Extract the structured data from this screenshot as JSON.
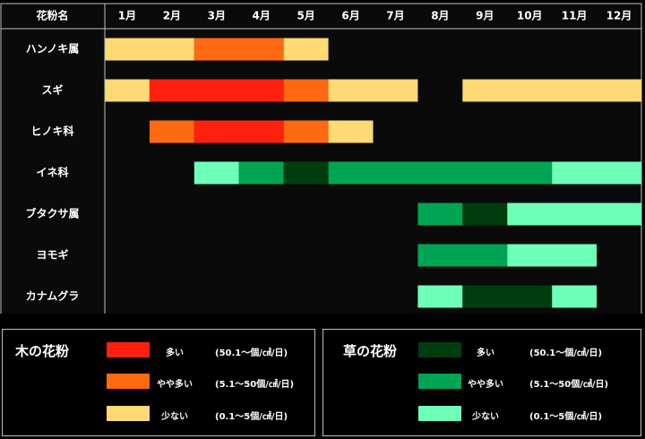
{
  "chart_data": {
    "type": "timeline-heatmap",
    "header_label": "花粉名",
    "months": [
      "1月",
      "2月",
      "3月",
      "4月",
      "5月",
      "6月",
      "7月",
      "8月",
      "9月",
      "10月",
      "11月",
      "12月"
    ],
    "levels": {
      "high": {
        "label": "多い",
        "range": "(50.1～個/㎠/日)"
      },
      "mid": {
        "label": "やや多い",
        "range": "(5.1～50個/㎠/日)"
      },
      "low": {
        "label": "少ない",
        "range": "(0.1～5個/㎠/日)"
      }
    },
    "colors": {
      "tree": {
        "high": "#ff2010",
        "mid": "#ff6a10",
        "low": "#ffd973"
      },
      "grass": {
        "high": "#003d0e",
        "mid": "#00a553",
        "low": "#6effb8"
      }
    },
    "rows": [
      {
        "name": "ハンノキ属",
        "kind": "tree",
        "segments": [
          {
            "start": 1,
            "end": 3,
            "level": "low"
          },
          {
            "start": 3,
            "end": 5,
            "level": "mid"
          },
          {
            "start": 5,
            "end": 6,
            "level": "low"
          }
        ]
      },
      {
        "name": "スギ",
        "kind": "tree",
        "segments": [
          {
            "start": 1,
            "end": 2,
            "level": "low"
          },
          {
            "start": 2,
            "end": 5,
            "level": "high"
          },
          {
            "start": 5,
            "end": 6,
            "level": "mid"
          },
          {
            "start": 6,
            "end": 8,
            "level": "low"
          },
          {
            "start": 9,
            "end": 13,
            "level": "low"
          }
        ]
      },
      {
        "name": "ヒノキ科",
        "kind": "tree",
        "segments": [
          {
            "start": 2,
            "end": 3,
            "level": "mid"
          },
          {
            "start": 3,
            "end": 5,
            "level": "high"
          },
          {
            "start": 5,
            "end": 6,
            "level": "mid"
          },
          {
            "start": 6,
            "end": 7,
            "level": "low"
          }
        ]
      },
      {
        "name": "イネ科",
        "kind": "grass",
        "segments": [
          {
            "start": 3,
            "end": 4,
            "level": "low"
          },
          {
            "start": 4,
            "end": 5,
            "level": "mid"
          },
          {
            "start": 5,
            "end": 6,
            "level": "high"
          },
          {
            "start": 6,
            "end": 11,
            "level": "mid"
          },
          {
            "start": 11,
            "end": 13,
            "level": "low"
          }
        ]
      },
      {
        "name": "ブタクサ属",
        "kind": "grass",
        "segments": [
          {
            "start": 8,
            "end": 9,
            "level": "mid"
          },
          {
            "start": 9,
            "end": 10,
            "level": "high"
          },
          {
            "start": 10,
            "end": 13,
            "level": "low"
          }
        ]
      },
      {
        "name": "ヨモギ",
        "kind": "grass",
        "segments": [
          {
            "start": 8,
            "end": 10,
            "level": "mid"
          },
          {
            "start": 10,
            "end": 12,
            "level": "low"
          }
        ]
      },
      {
        "name": "カナムグラ",
        "kind": "grass",
        "segments": [
          {
            "start": 8,
            "end": 9,
            "level": "low"
          },
          {
            "start": 9,
            "end": 11,
            "level": "high"
          },
          {
            "start": 11,
            "end": 12,
            "level": "low"
          }
        ]
      }
    ]
  },
  "legend": {
    "tree_title": "木の花粉",
    "grass_title": "草の花粉"
  }
}
